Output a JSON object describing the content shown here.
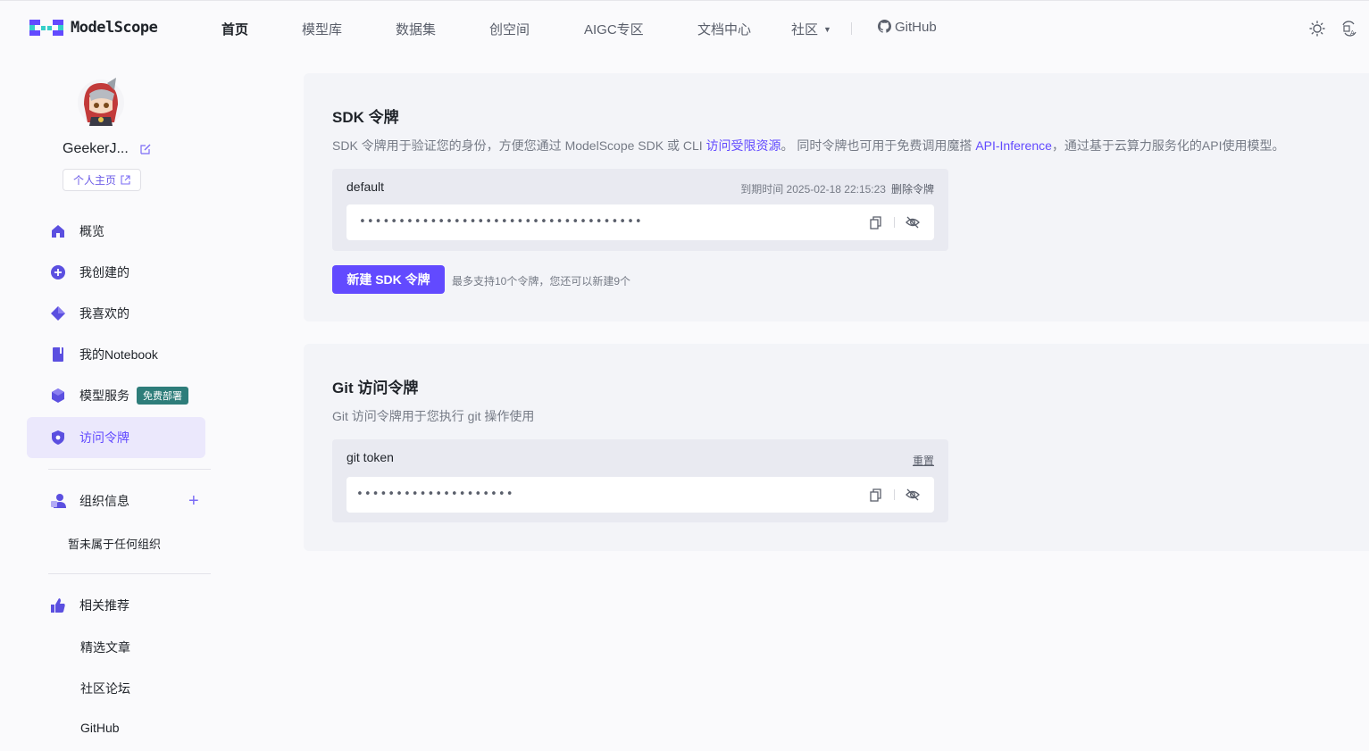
{
  "header": {
    "logo_text": "ModelScope",
    "nav": [
      {
        "label": "首页",
        "active": true
      },
      {
        "label": "模型库"
      },
      {
        "label": "数据集"
      },
      {
        "label": "创空间"
      },
      {
        "label": "AIGC专区"
      },
      {
        "label": "文档中心"
      },
      {
        "label": "社区"
      },
      {
        "label": "GitHub"
      }
    ],
    "icons": [
      "theme-toggle-icon",
      "language-icon"
    ]
  },
  "sidebar": {
    "username": "GeekerJ...",
    "homepage_label": "个人主页",
    "items": [
      {
        "label": "概览",
        "icon": "home-icon"
      },
      {
        "label": "我创建的",
        "icon": "plus-circle-icon"
      },
      {
        "label": "我喜欢的",
        "icon": "diamond-icon"
      },
      {
        "label": "我的Notebook",
        "icon": "notebook-icon"
      },
      {
        "label": "模型服务",
        "icon": "cube-icon",
        "badge": "免费部署"
      },
      {
        "label": "访问令牌",
        "icon": "shield-icon",
        "active": true
      }
    ],
    "org_title": "组织信息",
    "org_empty": "暂未属于任何组织",
    "recommend_title": "相关推荐",
    "links": [
      "精选文章",
      "社区论坛",
      "GitHub"
    ]
  },
  "sdk": {
    "title": "SDK 令牌",
    "desc_pre": "SDK 令牌用于验证您的身份，方便您通过 ModelScope SDK 或 CLI ",
    "desc_link1": "访问受限资源",
    "desc_mid": "。 同时令牌也可用于免费调用魔搭 ",
    "desc_link2": "API-Inference",
    "desc_post": "，通过基于云算力服务化的API使用模型。",
    "token": {
      "name": "default",
      "expire_label": "到期时间 2025-02-18 22:15:23",
      "delete_label": "删除令牌",
      "value": "••••••••••••••••••••••••••••••••••••"
    },
    "new_button": "新建 SDK 令牌",
    "hint": "最多支持10个令牌，您还可以新建9个"
  },
  "git": {
    "title": "Git 访问令牌",
    "desc": "Git 访问令牌用于您执行 git 操作使用",
    "token": {
      "name": "git token",
      "reset_label": "重置",
      "value": "••••••••••••••••••••"
    }
  },
  "colors": {
    "accent": "#624aff",
    "badge": "#2e7d7a",
    "active_bg": "#ebe8fc"
  }
}
